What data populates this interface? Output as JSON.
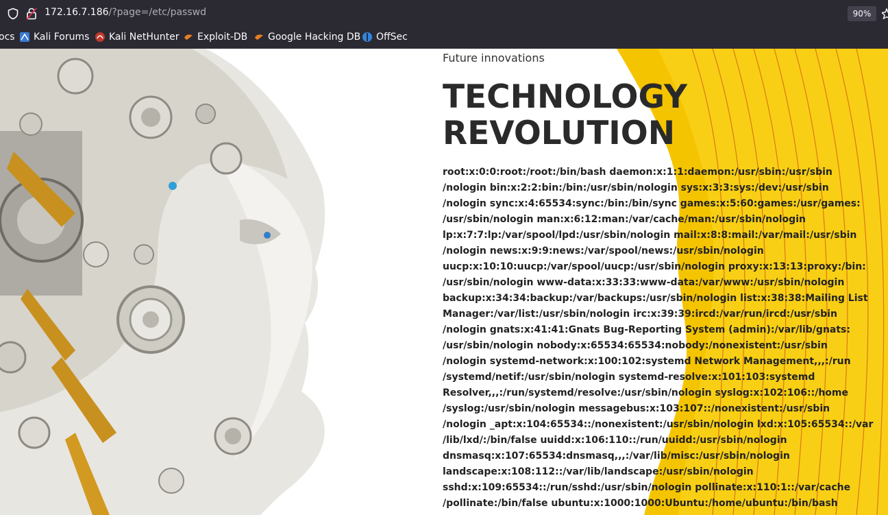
{
  "browser": {
    "url_host": "172.16.7.186",
    "url_path": "/?page=/etc/passwd",
    "zoom": "90%",
    "bookmarks": [
      {
        "label": "ocs",
        "icon": "none"
      },
      {
        "label": "Kali Forums",
        "icon": "kali-forums-icon"
      },
      {
        "label": "Kali NetHunter",
        "icon": "kali-nethunter-icon"
      },
      {
        "label": "Exploit-DB",
        "icon": "exploit-db-icon"
      },
      {
        "label": "Google Hacking DB",
        "icon": "ghdb-icon"
      },
      {
        "label": "OffSec",
        "icon": "offsec-icon"
      }
    ]
  },
  "hero": {
    "kicker": "Future innovations",
    "headline_line1": "TECHNOLOGY",
    "headline_line2": "REVOLUTION",
    "accent_color": "#f5c400"
  },
  "passwd_lines": [
    "root:x:0:0:root:/root:/bin/bash daemon:x:1:1:daemon:/usr/sbin:/usr/sbin",
    "/nologin bin:x:2:2:bin:/bin:/usr/sbin/nologin sys:x:3:3:sys:/dev:/usr/sbin",
    "/nologin sync:x:4:65534:sync:/bin:/bin/sync games:x:5:60:games:/usr/games:",
    "/usr/sbin/nologin man:x:6:12:man:/var/cache/man:/usr/sbin/nologin",
    "lp:x:7:7:lp:/var/spool/lpd:/usr/sbin/nologin mail:x:8:8:mail:/var/mail:/usr/sbin",
    "/nologin news:x:9:9:news:/var/spool/news:/usr/sbin/nologin",
    "uucp:x:10:10:uucp:/var/spool/uucp:/usr/sbin/nologin proxy:x:13:13:proxy:/bin:",
    "/usr/sbin/nologin www-data:x:33:33:www-data:/var/www:/usr/sbin/nologin",
    "backup:x:34:34:backup:/var/backups:/usr/sbin/nologin list:x:38:38:Mailing List",
    "Manager:/var/list:/usr/sbin/nologin irc:x:39:39:ircd:/var/run/ircd:/usr/sbin",
    "/nologin gnats:x:41:41:Gnats Bug-Reporting System (admin):/var/lib/gnats:",
    "/usr/sbin/nologin nobody:x:65534:65534:nobody:/nonexistent:/usr/sbin",
    "/nologin systemd-network:x:100:102:systemd Network Management,,,:/run",
    "/systemd/netif:/usr/sbin/nologin systemd-resolve:x:101:103:systemd",
    "Resolver,,,:/run/systemd/resolve:/usr/sbin/nologin syslog:x:102:106::/home",
    "/syslog:/usr/sbin/nologin messagebus:x:103:107::/nonexistent:/usr/sbin",
    "/nologin _apt:x:104:65534::/nonexistent:/usr/sbin/nologin lxd:x:105:65534::/var",
    "/lib/lxd/:/bin/false uuidd:x:106:110::/run/uuidd:/usr/sbin/nologin",
    "dnsmasq:x:107:65534:dnsmasq,,,:/var/lib/misc:/usr/sbin/nologin",
    "landscape:x:108:112::/var/lib/landscape:/usr/sbin/nologin",
    "sshd:x:109:65534::/run/sshd:/usr/sbin/nologin pollinate:x:110:1::/var/cache",
    "/pollinate:/bin/false ubuntu:x:1000:1000:Ubuntu:/home/ubuntu:/bin/bash"
  ]
}
